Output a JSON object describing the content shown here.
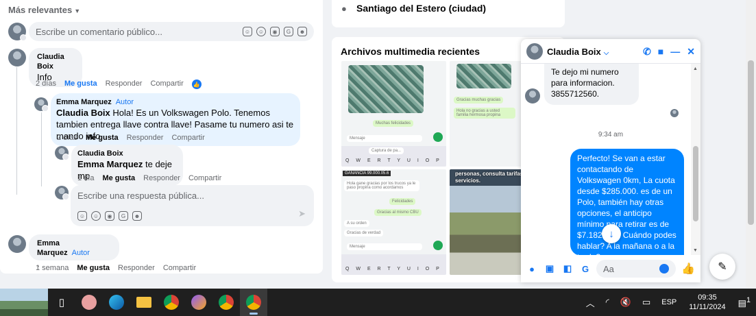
{
  "comments": {
    "sort_label": "Más relevantes",
    "comment_placeholder": "Escribe un comentario público...",
    "composer_tools": [
      "sticker-icon",
      "emoji-icon",
      "camera-icon",
      "gif-icon",
      "avatar-sticker-icon"
    ],
    "items": [
      {
        "author": "Claudia Boix",
        "text": "Info",
        "time": "2 días",
        "like": "Me gusta",
        "reply": "Responder",
        "share": "Compartir"
      },
      {
        "author": "Emma Marquez",
        "badge": "Autor",
        "text_name": "Claudia Boix",
        "text": "Hola! Es un Volkswagen Polo. Tenemos tambien entrega llave contra llave! Pasame tu numero asi te mando info.",
        "time": "2 días",
        "like": "Me gusta",
        "reply": "Responder",
        "share": "Compartir"
      },
      {
        "author": "Claudia Boix",
        "text_name": "Emma Marquez",
        "text": "te deje mp",
        "time": "1 día",
        "like": "Me gusta",
        "reply": "Responder",
        "share": "Compartir"
      },
      {
        "author": "Emma Marquez",
        "badge": "Autor",
        "text": ".",
        "time": "1 semana",
        "like": "Me gusta",
        "reply": "Responder",
        "share": "Compartir"
      }
    ],
    "reply_placeholder": "Escribe una respuesta pública..."
  },
  "location": {
    "text": "Santiago del Estero (ciudad)"
  },
  "media": {
    "title": "Archivos multimedia recientes",
    "tiles": {
      "t1_msg": "Muchas felicidades",
      "t1_input": "Mensaje",
      "t1_tag": "Captura de pa...",
      "t1_keys": "Q W E R T Y U I O P",
      "t2_msg1": "Gracias muchas gracias",
      "t2_msg2": "Hola no gracias a usted familia hermosa propina",
      "t3_tag": "GANANCIA 99.000.05.6",
      "t3_msg1": "Hola gane gracias por los trucos ya le paso propina como acordamos",
      "t3_msg2": "Felicidades",
      "t3_msg3": "Gracias al mismo CBU",
      "t3_msg4": "A su orden",
      "t3_msg5": "Gracias de verdad",
      "t3_input": "Mensaje",
      "t3_keys": "Q W E R T Y U I O P",
      "t4_text": "personas, consulta tarifas y servicios."
    }
  },
  "chat": {
    "name": "Claudia Boix",
    "incoming": "Te dejo mi numero para informacion. 3855712560.",
    "time": "9:34 am",
    "outgoing": "Perfecto!  Se van a estar contactando de Volkswagen 0km, La cuota desde $285.000. es de un Polo, también hay otras opciones, el anticipo mínimo para retirar es de $7.182.000. Cuándo podes hablar? A la mañana o a la tarde?",
    "input_placeholder": "Aa"
  },
  "taskbar": {
    "lang": "ESP",
    "time": "09:35",
    "date": "11/11/2024",
    "notif_count": "1"
  },
  "colors": {
    "accent": "#1877f2",
    "bubble_out": "#0084ff",
    "author_bubble": "#e7f3ff"
  }
}
